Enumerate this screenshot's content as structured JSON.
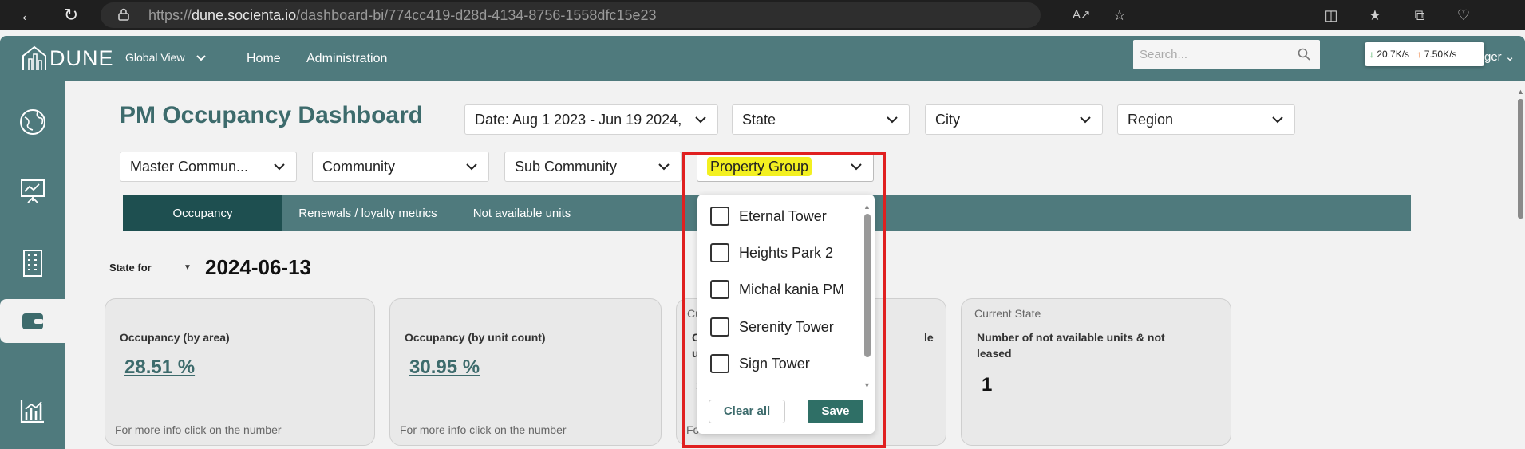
{
  "browser": {
    "url_prefix": "https://",
    "url_host": "dune.socienta.io",
    "url_path": "/dashboard-bi/774cc419-d28d-4134-8756-1558dfc15e23"
  },
  "header": {
    "logo_text": "DUNE",
    "global_view": "Global View",
    "home": "Home",
    "administration": "Administration",
    "search_placeholder": "Search...",
    "user_partial": "ger",
    "net_down": "20.7K/s",
    "net_up": "7.50K/s"
  },
  "page": {
    "title": "PM Occupancy Dashboard",
    "filters": {
      "date": "Date: Aug 1 2023 - Jun 19 2024,",
      "state": "State",
      "city": "City",
      "region": "Region",
      "master_community": "Master Commun...",
      "community": "Community",
      "sub_community": "Sub Community",
      "property_group": "Property Group"
    },
    "tabs": [
      "Occupancy",
      "Renewals / loyalty metrics",
      "Not available units"
    ],
    "state_for_label": "State for",
    "state_date": "2024-06-13"
  },
  "cards": [
    {
      "title": "Occupancy (by area)",
      "value": "28.51 %",
      "footer": "For more info click on the number"
    },
    {
      "title": "Occupancy (by unit count)",
      "value": "30.95 %",
      "footer": "For more info click on the number"
    },
    {
      "subtitle": "Cu",
      "title_partial_1": "C",
      "title_partial_2": "u",
      "value_partial": "1",
      "footer_partial": "Fo",
      "right_partial": "le"
    },
    {
      "subtitle": "Current State",
      "title": "Number of not available units & not leased",
      "value": "1"
    }
  ],
  "dropdown": {
    "options": [
      "Eternal Tower",
      "Heights Park 2",
      "Michał kania PM",
      "Serenity Tower",
      "Sign Tower"
    ],
    "clear_label": "Clear all",
    "save_label": "Save"
  },
  "colors": {
    "primary": "#4f7a7d",
    "primary_dark": "#1e4f50",
    "title": "#3d6b6c",
    "highlight": "#f3f020",
    "annotation": "#e02020"
  }
}
